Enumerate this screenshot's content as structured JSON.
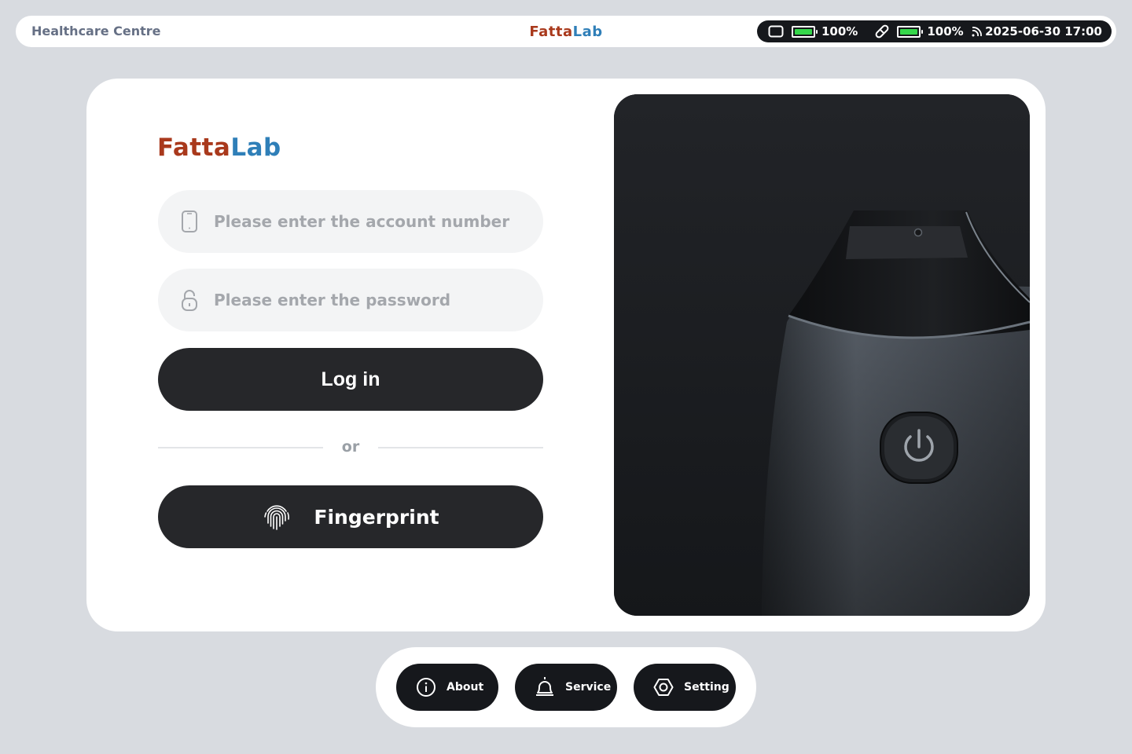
{
  "topbar": {
    "app_name": "Healthcare Centre",
    "brand_part1": "Fatta",
    "brand_part2": "Lab",
    "status": {
      "device_battery": "100%",
      "device_battery_level": 1.0,
      "pen_battery": "100%",
      "pen_battery_level": 1.0,
      "datetime": "2025-06-30 17:00"
    }
  },
  "login": {
    "brand_part1": "Fatta",
    "brand_part2": "Lab",
    "account_placeholder": "Please enter the account number",
    "password_placeholder": "Please enter the password",
    "login_label": "Log in",
    "or_label": "or",
    "fingerprint_label": "Fingerprint"
  },
  "dock": {
    "about_label": "About",
    "service_label": "Service",
    "setting_label": "Setting"
  },
  "colors": {
    "brand_red": "#a9391c",
    "brand_blue": "#2f7fb8",
    "battery_green": "#35d64a",
    "button_dark": "#26272a"
  },
  "icons": [
    "phone-icon",
    "lock-icon",
    "fingerprint-icon",
    "tablet-icon",
    "battery-icon",
    "pen-icon",
    "wifi-icon",
    "info-icon",
    "bell-icon",
    "gear-icon",
    "power-icon"
  ]
}
